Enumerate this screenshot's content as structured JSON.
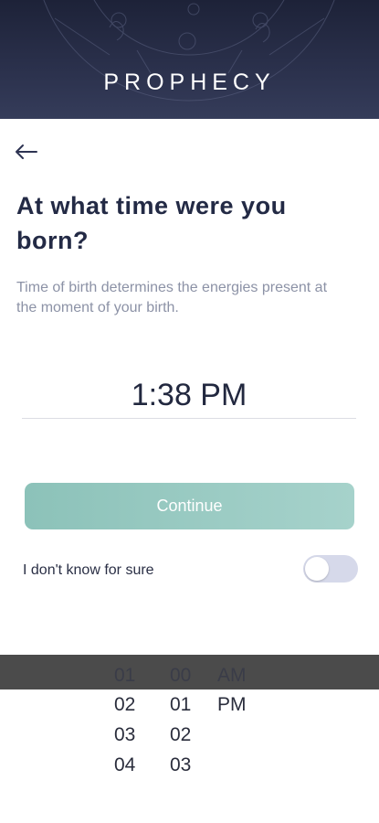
{
  "header": {
    "brand": "PROPHECY"
  },
  "back": {
    "icon": "arrow-left-icon"
  },
  "question": {
    "title": "At what time were you born?",
    "subtitle": "Time of birth determines the energies present at the moment of your birth."
  },
  "time": {
    "value": "1:38 PM"
  },
  "continue_label": "Continue",
  "unsure": {
    "label": "I don't know for sure",
    "enabled": false
  },
  "picker": {
    "hours": [
      "01",
      "02",
      "03",
      "04"
    ],
    "minutes": [
      "00",
      "01",
      "02",
      "03"
    ],
    "ampm": [
      "AM",
      "PM"
    ]
  },
  "colors": {
    "header_bg": "#2a304b",
    "accent": "#8cc2b9",
    "title": "#232a45",
    "muted": "#8c92a6",
    "toggle_off": "#d6d9ea"
  }
}
